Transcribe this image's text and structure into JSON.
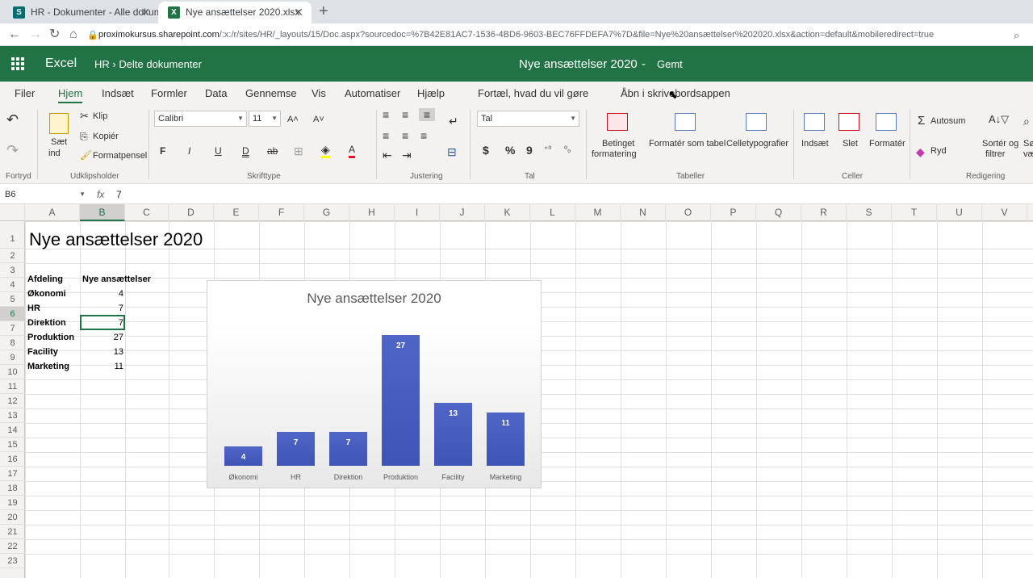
{
  "browser": {
    "tabs": [
      {
        "label": "HR - Dokumenter - Alle dokumer",
        "favicon": "S"
      },
      {
        "label": "Nye ansættelser 2020.xlsx",
        "favicon": "X"
      }
    ],
    "url_host": "proximokursus.sharepoint.com",
    "url_path": "/:x:/r/sites/HR/_layouts/15/Doc.aspx?sourcedoc=%7B42E81AC7-1536-4BD6-9603-BEC76FFDEFA7%7D&file=Nye%20ansættelser%202020.xlsx&action=default&mobileredirect=true"
  },
  "header": {
    "app": "Excel",
    "crumb_site": "HR",
    "crumb_sep": "›",
    "crumb_folder": "Delte dokumenter",
    "doc_title": "Nye ansættelser 2020",
    "dash": "-",
    "status": "Gemt"
  },
  "menu": [
    "Filer",
    "Hjem",
    "Indsæt",
    "Formler",
    "Data",
    "Gennemse",
    "Vis",
    "Automatiser",
    "Hjælp",
    "Fortæl, hvad du vil gøre",
    "Åbn i skrivebordsappen"
  ],
  "ribbon": {
    "undo_group": "Fortryd",
    "paste": "Sæt",
    "paste2": "ind",
    "cut": "Klip",
    "copy": "Kopiér",
    "format_painter": "Formatpensel",
    "clipboard_group": "Udklipsholder",
    "font": "Calibri",
    "size": "11",
    "bold": "F",
    "italic": "I",
    "underline": "U",
    "double_underline": "D",
    "strike": "ab",
    "font_group": "Skrifttype",
    "align_group": "Justering",
    "number_format": "Tal",
    "currency": "$",
    "percent": "%",
    "comma": "9",
    "number_group": "Tal",
    "cond_format": "Betinget",
    "cond_format2": "formatering",
    "format_table": "Formatér som tabel",
    "cell_styles": "Celletypografier",
    "tables_group": "Tabeller",
    "insert": "Indsæt",
    "delete": "Slet",
    "format": "Formatér",
    "cells_group": "Celler",
    "autosum": "Autosum",
    "clear": "Ryd",
    "sort": "Sortér og",
    "sort2": "filtrer",
    "find": "Sø",
    "find2": "væ",
    "editing_group": "Redigering"
  },
  "formula_bar": {
    "name_box": "B6",
    "fx": "fx",
    "value": "7"
  },
  "columns": [
    "A",
    "B",
    "C",
    "D",
    "E",
    "F",
    "G",
    "H",
    "I",
    "J",
    "K",
    "L",
    "M",
    "N",
    "O",
    "P",
    "Q",
    "R",
    "S",
    "T",
    "U",
    "V"
  ],
  "rows": [
    "1",
    "2",
    "3",
    "4",
    "5",
    "6",
    "7",
    "8",
    "9",
    "10",
    "11",
    "12",
    "13",
    "14",
    "15",
    "16",
    "17",
    "18",
    "19",
    "20",
    "21",
    "22",
    "23"
  ],
  "sheet": {
    "title": "Nye ansættelser 2020",
    "header_a": "Afdeling",
    "header_b": "Nye ansættelser",
    "data": [
      {
        "dept": "Økonomi",
        "count": "4"
      },
      {
        "dept": "HR",
        "count": "7"
      },
      {
        "dept": "Direktion",
        "count": "7"
      },
      {
        "dept": "Produktion",
        "count": "27"
      },
      {
        "dept": "Facility",
        "count": "13"
      },
      {
        "dept": "Marketing",
        "count": "11"
      }
    ]
  },
  "chart_data": {
    "type": "bar",
    "title": "Nye ansættelser 2020",
    "categories": [
      "Økonomi",
      "HR",
      "Direktion",
      "Produktion",
      "Facility",
      "Marketing"
    ],
    "values": [
      4,
      7,
      7,
      27,
      13,
      11
    ],
    "xlabel": "",
    "ylabel": "",
    "ylim": [
      0,
      27
    ],
    "grid": false,
    "data_labels": true,
    "bar_color": "#4356b8"
  },
  "colors": {
    "excel_green": "#217346"
  }
}
